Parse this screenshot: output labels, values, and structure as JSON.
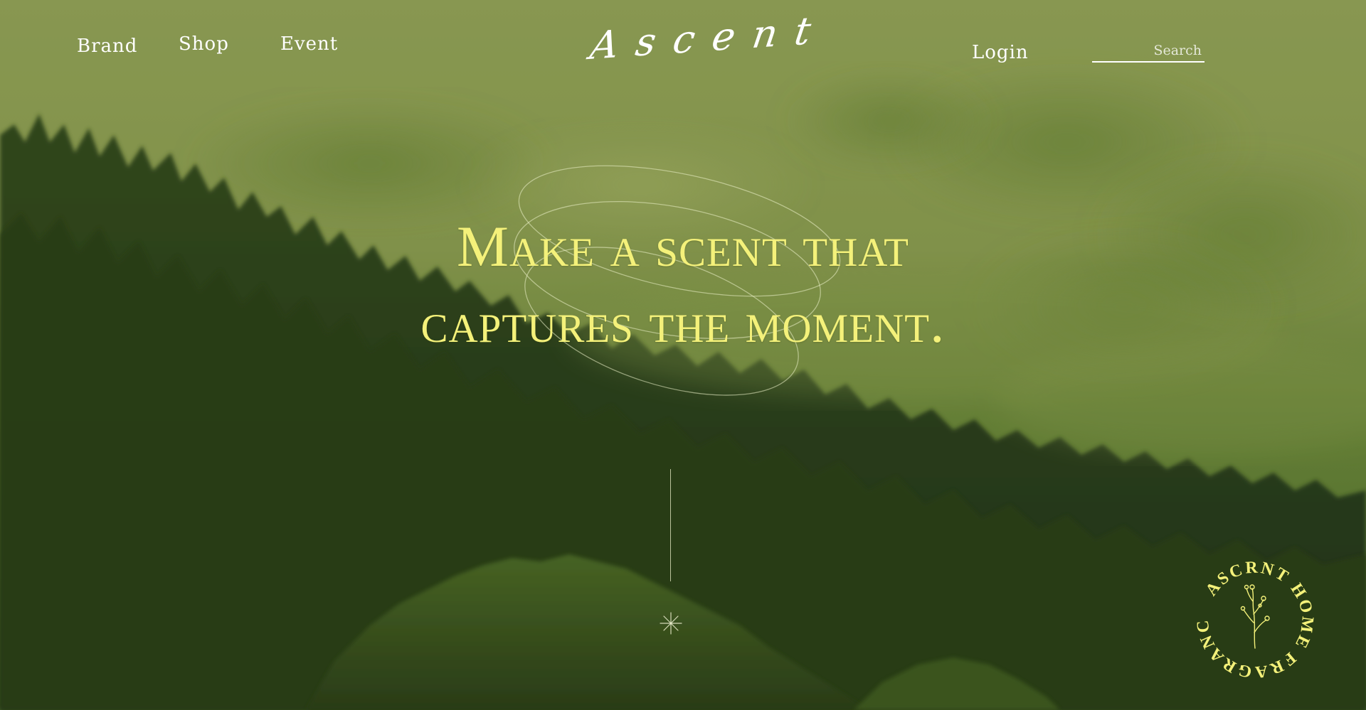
{
  "nav": {
    "links": [
      {
        "label": "Brand"
      },
      {
        "label": "Shop"
      },
      {
        "label": "Event"
      }
    ],
    "logo": "Ascent",
    "login_label": "Login",
    "search": {
      "placeholder": "Search",
      "value": ""
    }
  },
  "hero": {
    "headline_line_1": "Make a scent that",
    "headline_line_2": "captures the moment."
  },
  "badge": {
    "text": "ASCRNT HOME FRAGRANCR"
  },
  "colors": {
    "accent": "#f4f17a",
    "sky": "#99a85a",
    "forest": "#2a3c18"
  },
  "icons": [
    "sparkle-icon",
    "botanical-sprig-icon"
  ]
}
